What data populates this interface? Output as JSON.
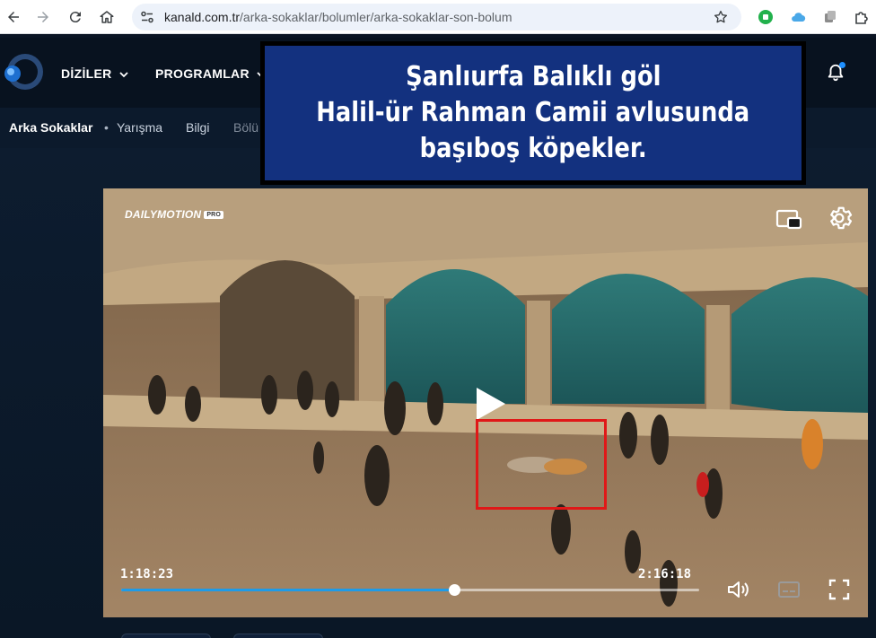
{
  "browser": {
    "url_host": "kanald.com.tr",
    "url_path": "/arka-sokaklar/bolumler/arka-sokaklar-son-bolum"
  },
  "site": {
    "menu": [
      {
        "label": "DİZİLER"
      },
      {
        "label": "PROGRAMLAR"
      }
    ],
    "show_title": "Arka Sokaklar",
    "subnav": [
      "Yarışma",
      "Bilgi",
      "Bölü"
    ]
  },
  "caption": {
    "lines": [
      "Şanlıurfa Balıklı göl",
      "Halil-ür Rahman Camii avlusunda",
      "başıboş köpekler."
    ],
    "background": "#13317f"
  },
  "player": {
    "brand": "DAILYMOTION",
    "brand_badge": "PRO",
    "current_time": "1:18:23",
    "duration": "2:16:18",
    "progress": 0.576,
    "progress_color": "#1e9be8",
    "highlight_color": "#e01818",
    "icons": [
      "picture-in-picture-icon",
      "settings-gear-icon",
      "play-icon",
      "volume-icon",
      "subtitles-icon",
      "fullscreen-icon"
    ]
  }
}
